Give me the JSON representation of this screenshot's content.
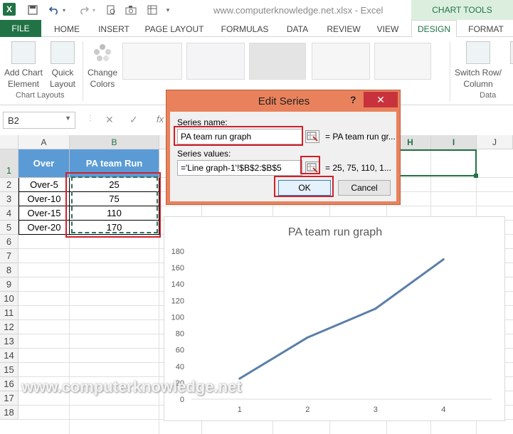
{
  "window": {
    "title": "www.computerknowledge.net.xlsx - Excel",
    "context_tab_group": "CHART TOOLS"
  },
  "ribbon_tabs": [
    "FILE",
    "HOME",
    "INSERT",
    "PAGE LAYOUT",
    "FORMULAS",
    "DATA",
    "REVIEW",
    "VIEW",
    "DESIGN",
    "FORMAT"
  ],
  "ribbon": {
    "add_chart_element": "Add Chart Element",
    "add_chart_element_l1": "Add Chart",
    "add_chart_element_l2": "Element",
    "quick_layout_l1": "Quick",
    "quick_layout_l2": "Layout",
    "change_colors_l1": "Change",
    "change_colors_l2": "Colors",
    "chart_layouts_group": "Chart Layouts",
    "switch_row_col_l1": "Switch Row/",
    "switch_row_col_l2": "Column",
    "data_group": "Data"
  },
  "formula_bar": {
    "name_box": "B2",
    "fx": "fx"
  },
  "sheet": {
    "columns": [
      "A",
      "B",
      "C",
      "D",
      "E",
      "F",
      "G",
      "H",
      "I",
      "J"
    ],
    "rows": [
      "1",
      "2",
      "3",
      "4",
      "5",
      "6",
      "7",
      "8",
      "9",
      "10",
      "11",
      "12",
      "13",
      "14",
      "15",
      "16",
      "17",
      "18"
    ],
    "header": [
      "Over",
      "PA team Run"
    ],
    "data": [
      [
        "Over-5",
        "25"
      ],
      [
        "Over-10",
        "75"
      ],
      [
        "Over-15",
        "110"
      ],
      [
        "Over-20",
        "170"
      ]
    ]
  },
  "dialog": {
    "title": "Edit Series",
    "help": "?",
    "close": "✕",
    "series_name_label": "Series name:",
    "series_name_value": "PA team run graph",
    "series_name_preview": "= PA team run gr...",
    "series_values_label": "Series values:",
    "series_values_value": "='Line graph-1'!$B$2:$B$5",
    "series_values_preview": "= 25, 75, 110, 1...",
    "ok": "OK",
    "cancel": "Cancel"
  },
  "chart_data": {
    "type": "line",
    "title": "PA team run graph",
    "x": [
      1,
      2,
      3,
      4
    ],
    "series": [
      {
        "name": "PA team run graph",
        "values": [
          25,
          75,
          110,
          170
        ],
        "color": "#5b7fa8"
      }
    ],
    "yticks": [
      0,
      20,
      40,
      60,
      80,
      100,
      120,
      140,
      160,
      180
    ],
    "ylim": [
      0,
      180
    ],
    "xlabel": "",
    "ylabel": "",
    "grid": false,
    "legend": "none"
  },
  "watermark": "www.computerknowledge.net",
  "colors": {
    "excel_green": "#217346",
    "header_fill": "#5b9bd5",
    "dialog_frame": "#e9825c",
    "highlight_red": "#d0202a",
    "close_red": "#c8323c"
  }
}
